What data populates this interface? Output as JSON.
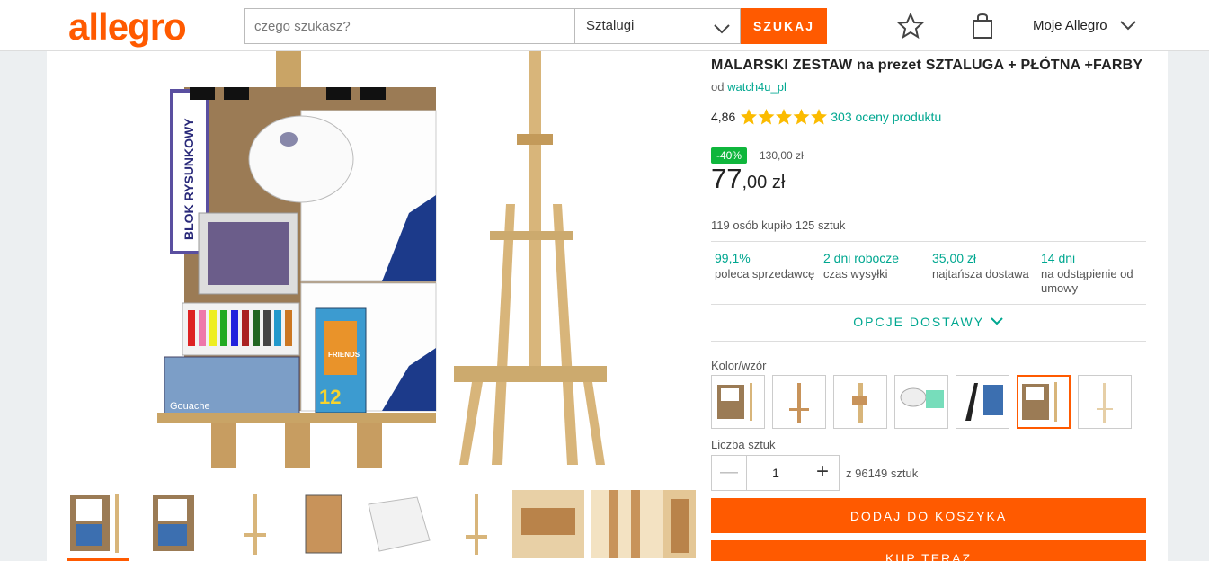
{
  "header": {
    "logo": "allegro",
    "search_placeholder": "czego szukasz?",
    "category": "Sztalugi",
    "search_button": "SZUKAJ",
    "account": "Moje Allegro"
  },
  "product": {
    "title": "MALARSKI ZESTAW na prezet SZTALUGA + PŁÓTNA +FARBY",
    "seller_prefix": "od",
    "seller": "watch4u_pl",
    "rating": "4,86",
    "rating_count": "303 oceny produktu",
    "stars": 5,
    "discount": "-40%",
    "old_price": "130,00 zł",
    "price_main": "77",
    "price_rest": ",00 zł",
    "bought": "119 osób kupiło 125 sztuk",
    "hero_image_texts": [
      "BLOK RYSUNKOWY",
      "FRIENDS",
      "12",
      "Gouache"
    ]
  },
  "info": [
    {
      "value": "99,1%",
      "label": "poleca sprzedawcę"
    },
    {
      "value": "2 dni robocze",
      "label": "czas wysyłki"
    },
    {
      "value": "35,00 zł",
      "label": "najtańsza dostawa"
    },
    {
      "value": "14 dni",
      "label": "na odstąpienie od umowy"
    }
  ],
  "delivery_options": "OPCJE DOSTAWY",
  "variant_label": "Kolor/wzór",
  "variants": [
    "zestaw-sztaluga-plotna",
    "sztaluga",
    "sztaluga-bok",
    "paleta-farby",
    "sztaluga-czarna-zestaw",
    "zestaw-pelny",
    "sztaluga-mala"
  ],
  "active_variant_index": 5,
  "quantity": {
    "label": "Liczba sztuk",
    "value": "1",
    "available": "z 96149 sztuk",
    "minus": "—",
    "plus": "+"
  },
  "buttons": {
    "add_to_cart": "DODAJ DO KOSZYKA",
    "buy_now": "KUP TERAZ"
  },
  "colors": {
    "brand": "#ff5a00",
    "link": "#00a790",
    "discount": "#0fb63c",
    "star": "#fbbb00"
  }
}
